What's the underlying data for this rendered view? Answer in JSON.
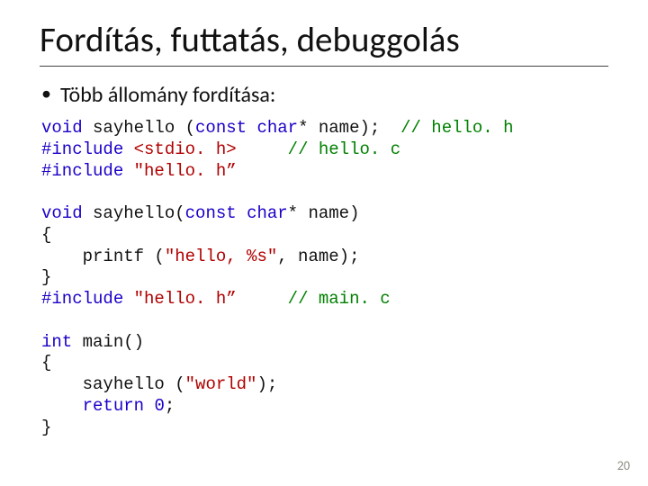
{
  "title": "Fordítás, futtatás, debuggolás",
  "bullets": [
    {
      "text": "Több állomány fordítása:"
    }
  ],
  "code": {
    "l1a": "void",
    "l1b": " sayhello (",
    "l1c": "const",
    "l1d": " ",
    "l1e": "char",
    "l1f": "* name);  ",
    "l1g": "// hello. h",
    "l2a": "#include",
    "l2b": " ",
    "l2c": "<stdio. h>",
    "l2d": "     ",
    "l2e": "// hello. c",
    "l3a": "#include",
    "l3b": " ",
    "l3c": "\"hello. h”",
    "blank1": "",
    "l4a": "void",
    "l4b": " sayhello(",
    "l4c": "const",
    "l4d": " ",
    "l4e": "char",
    "l4f": "* name)",
    "l5": "{",
    "l6a": "    printf (",
    "l6b": "\"hello, %s\"",
    "l6c": ", name);",
    "l7": "}",
    "l8a": "#include",
    "l8b": " ",
    "l8c": "\"hello. h”",
    "l8d": "     ",
    "l8e": "// main. c",
    "blank2": "",
    "l9a": "int",
    "l9b": " main()",
    "l10": "{",
    "l11a": "    sayhello (",
    "l11b": "\"world\"",
    "l11c": ");",
    "l12a": "    ",
    "l12b": "return",
    "l12c": " ",
    "l12d": "0",
    "l12e": ";",
    "l13": "}"
  },
  "page_number": "20"
}
